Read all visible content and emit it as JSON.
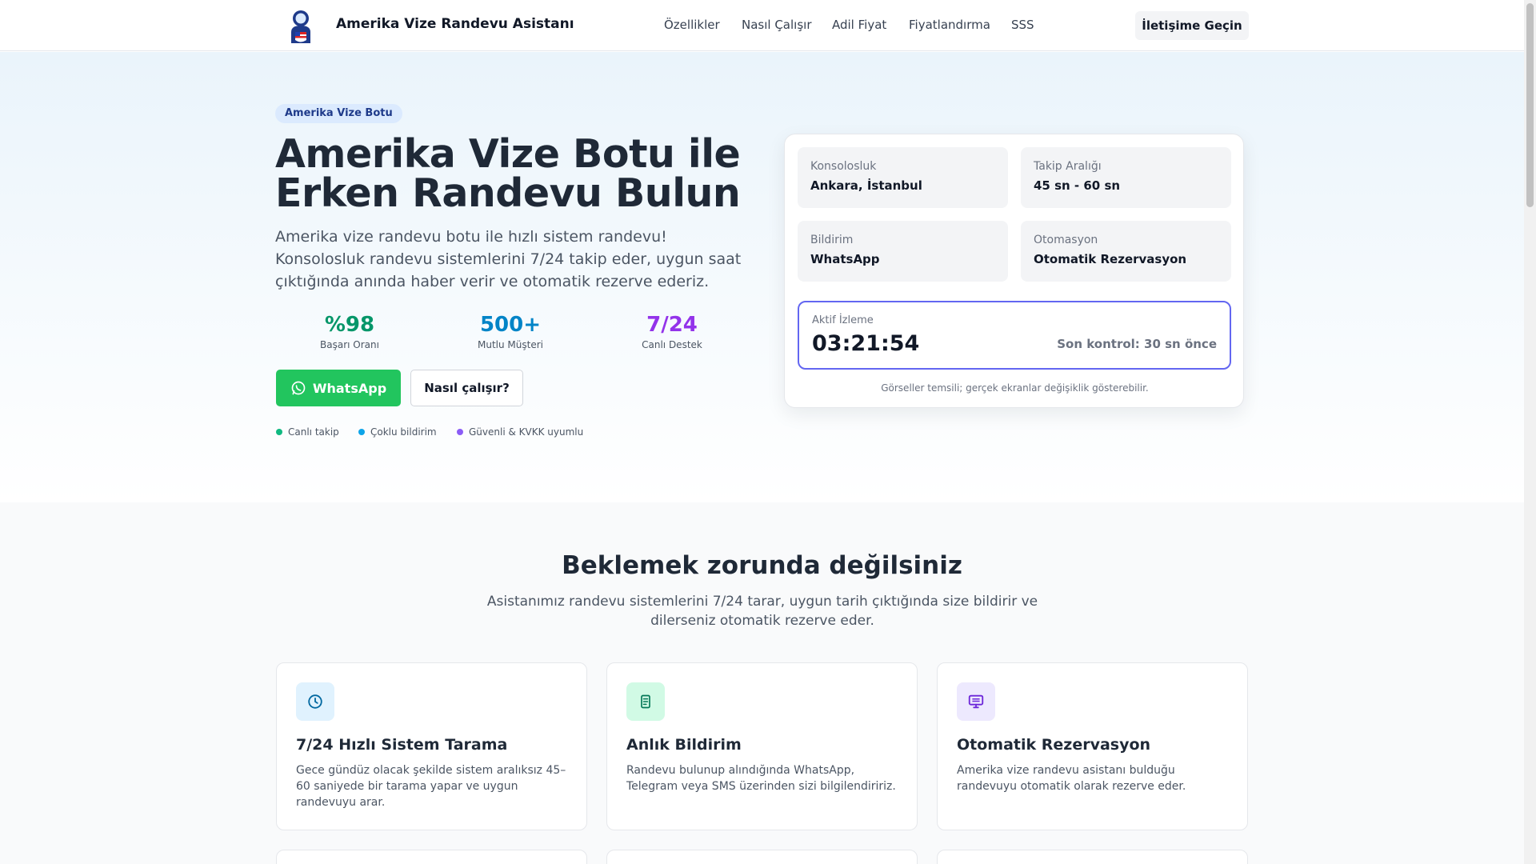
{
  "header": {
    "brand": "Amerika Vize Randevu Asistanı",
    "nav": [
      {
        "label": "Özellikler"
      },
      {
        "label": "Nasıl Çalışır"
      },
      {
        "label": "Adil Fiyat"
      },
      {
        "label": "Fiyatlandırma"
      },
      {
        "label": "SSS"
      }
    ],
    "contact_button": "İletişime Geçin"
  },
  "hero": {
    "badge": "Amerika Vize Botu",
    "title": "Amerika Vize Botu ile Erken Randevu Bulun",
    "description": "Amerika vize randevu botu ile hızlı sistem randevu! Konsolosluk randevu sistemlerini 7/24 takip eder, uygun saat çıktığında anında haber verir ve otomatik rezerve ederiz.",
    "stats": [
      {
        "value": "%98",
        "label": "Başarı Oranı",
        "color": "#059669"
      },
      {
        "value": "500+",
        "label": "Mutlu Müşteri",
        "color": "#0284c7"
      },
      {
        "value": "7/24",
        "label": "Canlı Destek",
        "color": "#9333ea"
      }
    ],
    "whatsapp_button": "WhatsApp",
    "how_button": "Nasıl çalışır?",
    "tags": [
      {
        "label": "Canlı takip",
        "color": "#10b981"
      },
      {
        "label": "Çoklu bildirim",
        "color": "#0ea5e9"
      },
      {
        "label": "Güvenli & KVKK uyumlu",
        "color": "#8b5cf6"
      }
    ]
  },
  "status_card": {
    "items": [
      {
        "label": "Konsolosluk",
        "value": "Ankara, İstanbul"
      },
      {
        "label": "Takip Aralığı",
        "value": "45 sn - 60 sn"
      },
      {
        "label": "Bildirim",
        "value": "WhatsApp"
      },
      {
        "label": "Otomasyon",
        "value": "Otomatik Rezervasyon"
      }
    ],
    "monitor_label": "Aktif İzleme",
    "monitor_time": "03:21:54",
    "last_check": "Son kontrol: 30 sn önce",
    "note": "Görseller temsili; gerçek ekranlar değişiklik gösterebilir."
  },
  "features": {
    "title": "Beklemek zorunda değilsiniz",
    "description": "Asistanımız randevu sistemlerini 7/24 tarar, uygun tarih çıktığında size bildirir ve dilerseniz otomatik rezerve eder.",
    "cards": [
      {
        "icon": "clock-icon",
        "title": "7/24 Hızlı Sistem Tarama",
        "description": "Gece gündüz olacak şekilde sistem aralıksız 45–60 saniyede bir tarama yapar ve uygun randevuyu arar.",
        "icon_bg": "#e0f2fe",
        "icon_color": "#0369a1"
      },
      {
        "icon": "notification-icon",
        "title": "Anlık Bildirim",
        "description": "Randevu bulunup alındığında WhatsApp, Telegram veya SMS üzerinden sizi bilgilendiririz.",
        "icon_bg": "#d1fae5",
        "icon_color": "#047857"
      },
      {
        "icon": "monitor-icon",
        "title": "Otomatik Rezervasyon",
        "description": "Amerika vize randevu asistanı bulduğu randevuyu otomatik olarak rezerve eder.",
        "icon_bg": "#ede9fe",
        "icon_color": "#6d28d9"
      }
    ]
  }
}
